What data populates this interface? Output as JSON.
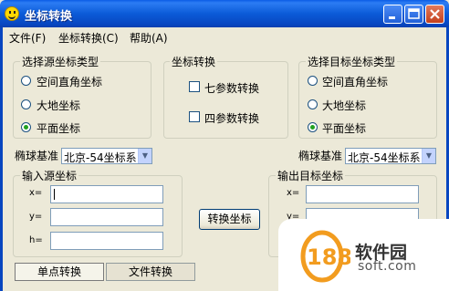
{
  "window": {
    "title": "坐标转换"
  },
  "menu": [
    {
      "label": "文件(F)"
    },
    {
      "label": "坐标转换(C)"
    },
    {
      "label": "帮助(A)"
    }
  ],
  "source_type": {
    "title": "选择源坐标类型",
    "options": [
      {
        "label": "空间直角坐标",
        "selected": false
      },
      {
        "label": "大地坐标",
        "selected": false
      },
      {
        "label": "平面坐标",
        "selected": true
      }
    ]
  },
  "transform": {
    "title": "坐标转换",
    "options": [
      {
        "label": "七参数转换",
        "checked": false
      },
      {
        "label": "四参数转换",
        "checked": false
      }
    ]
  },
  "target_type": {
    "title": "选择目标坐标类型",
    "options": [
      {
        "label": "空间直角坐标",
        "selected": false
      },
      {
        "label": "大地坐标",
        "selected": false
      },
      {
        "label": "平面坐标",
        "selected": true
      }
    ]
  },
  "ellipsoid_source": {
    "label": "椭球基准",
    "value": "北京-54坐标系"
  },
  "ellipsoid_target": {
    "label": "椭球基准",
    "value": "北京-54坐标系"
  },
  "input_coords": {
    "title": "输入源坐标",
    "fields": [
      {
        "label": "x=",
        "value": ""
      },
      {
        "label": "y=",
        "value": ""
      },
      {
        "label": "h=",
        "value": ""
      }
    ]
  },
  "output_coords": {
    "title": "输出目标坐标",
    "fields": [
      {
        "label": "x=",
        "value": ""
      },
      {
        "label": "y=",
        "value": ""
      }
    ]
  },
  "convert_button": "转换坐标",
  "tabs": [
    {
      "label": "单点转换",
      "active": true
    },
    {
      "label": "文件转换",
      "active": false
    }
  ],
  "watermark": {
    "logo": "188",
    "name": "软件园",
    "domain": "soft.com"
  }
}
